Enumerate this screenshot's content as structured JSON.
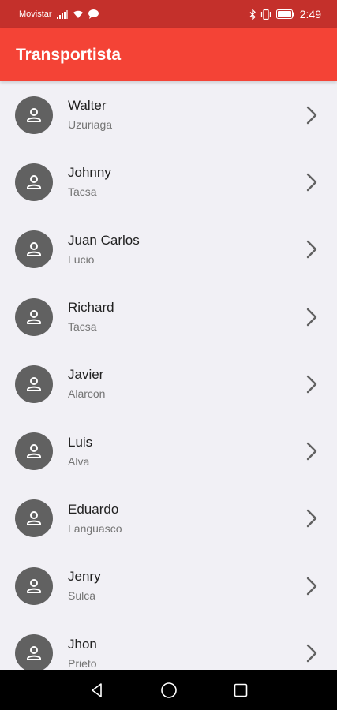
{
  "status_bar": {
    "carrier": "Movistar",
    "time": "2:49",
    "icons": [
      "signal-icon",
      "wifi-icon",
      "message-icon",
      "bluetooth-icon",
      "vibrate-icon",
      "battery-icon"
    ]
  },
  "app_bar": {
    "title": "Transportista",
    "color": "#f44336"
  },
  "drivers": [
    {
      "first_name": "Walter",
      "last_name": "Uzuriaga"
    },
    {
      "first_name": "Johnny",
      "last_name": "Tacsa"
    },
    {
      "first_name": "Juan Carlos",
      "last_name": "Lucio"
    },
    {
      "first_name": "Richard",
      "last_name": "Tacsa"
    },
    {
      "first_name": "Javier",
      "last_name": "Alarcon"
    },
    {
      "first_name": "Luis",
      "last_name": "Alva"
    },
    {
      "first_name": "Eduardo",
      "last_name": "Languasco"
    },
    {
      "first_name": "Jenry",
      "last_name": "Sulca"
    },
    {
      "first_name": "Jhon",
      "last_name": "Prieto"
    }
  ],
  "nav_bar": {
    "buttons": [
      "back-icon",
      "home-icon",
      "recents-icon"
    ]
  }
}
